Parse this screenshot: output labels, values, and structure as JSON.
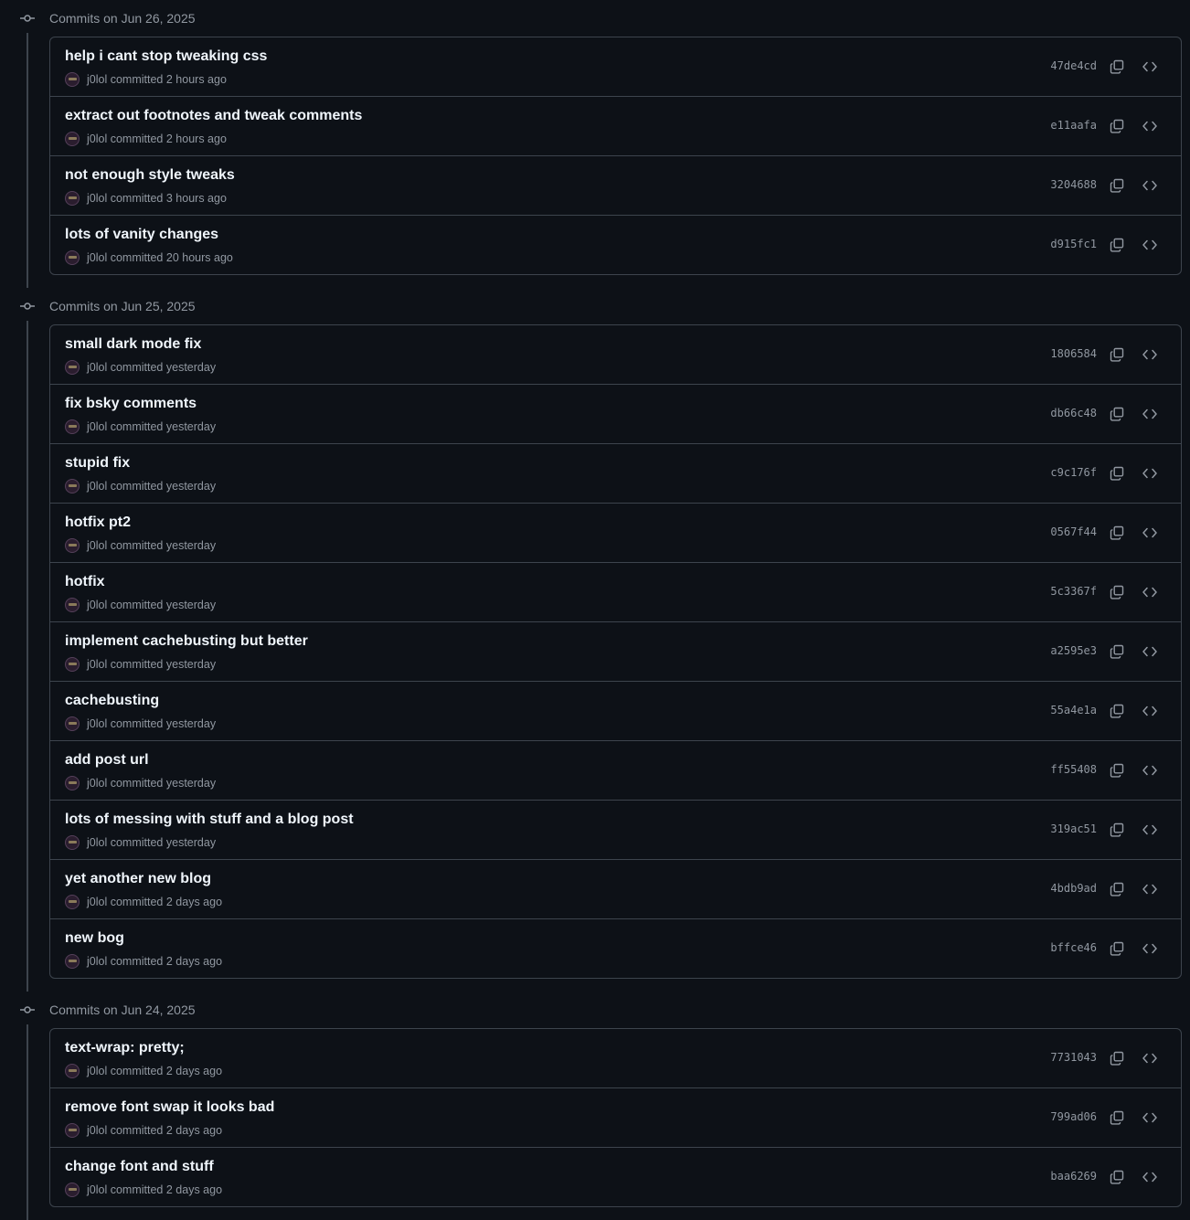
{
  "groups": [
    {
      "title": "Commits on Jun 26, 2025",
      "commits": [
        {
          "message": "help i cant stop tweaking css",
          "author": "j0lol",
          "action": "committed",
          "time": "2 hours ago",
          "sha": "47de4cd"
        },
        {
          "message": "extract out footnotes and tweak comments",
          "author": "j0lol",
          "action": "committed",
          "time": "2 hours ago",
          "sha": "e11aafa"
        },
        {
          "message": "not enough style tweaks",
          "author": "j0lol",
          "action": "committed",
          "time": "3 hours ago",
          "sha": "3204688"
        },
        {
          "message": "lots of vanity changes",
          "author": "j0lol",
          "action": "committed",
          "time": "20 hours ago",
          "sha": "d915fc1"
        }
      ]
    },
    {
      "title": "Commits on Jun 25, 2025",
      "commits": [
        {
          "message": "small dark mode fix",
          "author": "j0lol",
          "action": "committed",
          "time": "yesterday",
          "sha": "1806584"
        },
        {
          "message": "fix bsky comments",
          "author": "j0lol",
          "action": "committed",
          "time": "yesterday",
          "sha": "db66c48"
        },
        {
          "message": "stupid fix",
          "author": "j0lol",
          "action": "committed",
          "time": "yesterday",
          "sha": "c9c176f"
        },
        {
          "message": "hotfix pt2",
          "author": "j0lol",
          "action": "committed",
          "time": "yesterday",
          "sha": "0567f44"
        },
        {
          "message": "hotfix",
          "author": "j0lol",
          "action": "committed",
          "time": "yesterday",
          "sha": "5c3367f"
        },
        {
          "message": "implement cachebusting but better",
          "author": "j0lol",
          "action": "committed",
          "time": "yesterday",
          "sha": "a2595e3"
        },
        {
          "message": "cachebusting",
          "author": "j0lol",
          "action": "committed",
          "time": "yesterday",
          "sha": "55a4e1a"
        },
        {
          "message": "add post url",
          "author": "j0lol",
          "action": "committed",
          "time": "yesterday",
          "sha": "ff55408"
        },
        {
          "message": "lots of messing with stuff and a blog post",
          "author": "j0lol",
          "action": "committed",
          "time": "yesterday",
          "sha": "319ac51"
        },
        {
          "message": "yet another new blog",
          "author": "j0lol",
          "action": "committed",
          "time": "2 days ago",
          "sha": "4bdb9ad"
        },
        {
          "message": "new bog",
          "author": "j0lol",
          "action": "committed",
          "time": "2 days ago",
          "sha": "bffce46"
        }
      ]
    },
    {
      "title": "Commits on Jun 24, 2025",
      "commits": [
        {
          "message": "text-wrap: pretty;",
          "author": "j0lol",
          "action": "committed",
          "time": "2 days ago",
          "sha": "7731043"
        },
        {
          "message": "remove font swap it looks bad",
          "author": "j0lol",
          "action": "committed",
          "time": "2 days ago",
          "sha": "799ad06"
        },
        {
          "message": "change font and stuff",
          "author": "j0lol",
          "action": "committed",
          "time": "2 days ago",
          "sha": "baa6269"
        }
      ]
    }
  ],
  "icons": {
    "group": "git-commit-icon",
    "copy": "copy-icon",
    "browse": "code-icon",
    "avatar": "avatar"
  },
  "colors": {
    "background": "#0d1117",
    "border": "#3d444d",
    "text": "#f0f6fc",
    "muted": "#9198a1"
  }
}
